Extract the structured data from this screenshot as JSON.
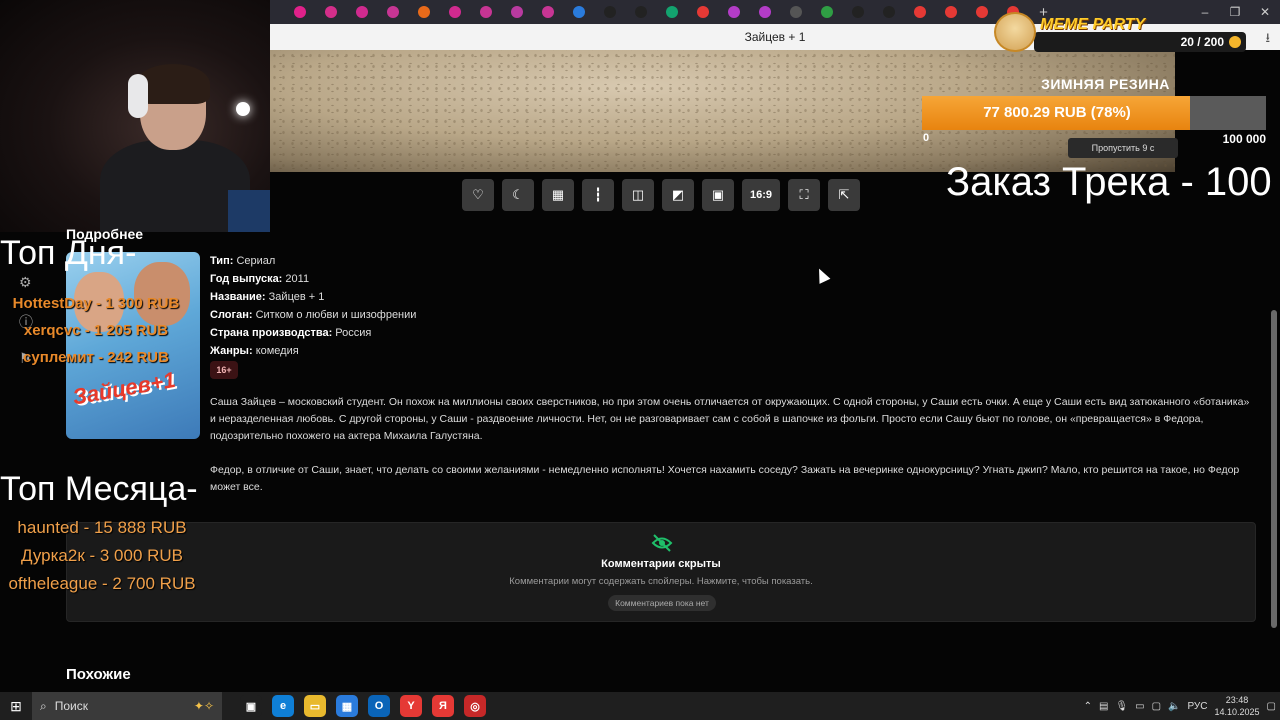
{
  "browser": {
    "tab_colors": [
      "#e0218a",
      "#d42e8a",
      "#d02a8f",
      "#c73594",
      "#e86a1a",
      "#d02a8f",
      "#c73594",
      "#b93aa0",
      "#c73594",
      "#2a7bdc",
      "#222222",
      "#222222",
      "#13a36f",
      "#e53935",
      "#b33cc7",
      "#b33cc7",
      "#555555",
      "#2f9e44",
      "#222222",
      "#222222",
      "#e53935",
      "#e53935",
      "#e53935",
      "#e53935"
    ],
    "new_tab": "+",
    "window_controls": [
      "–",
      "❐",
      "✕"
    ],
    "page_title": "Зайцев + 1",
    "download_icon": "download-icon"
  },
  "overlay": {
    "meme_title": "MEME PARTY",
    "meme_count": "20 / 200",
    "goal_title": "ЗИМНЯЯ РЕЗИНА",
    "goal_amount": "77 800.29 RUB (78%)",
    "goal_fraction": 0.78,
    "goal_min": "0",
    "goal_max": "100 000",
    "skip": "Пропустить 9 с",
    "order": "Заказ Трека - 100",
    "top_day_title": "Топ Дня-",
    "top_day": [
      "HottestDay - 1 300 RUB",
      "xerqcvc - 1 205 RUB",
      "суплемит - 242 RUB"
    ],
    "top_month_title": "Топ Месяца-",
    "top_month": [
      "haunted - 15 888 RUB",
      "Дурка2к - 3 000 RUB",
      "oftheleague - 2 700 RUB"
    ]
  },
  "player_toolbar": [
    "heart-icon",
    "moon-icon",
    "grid-icon",
    "waveform-icon",
    "split-icon",
    "picture-icon",
    "pip-icon",
    "aspect-ratio",
    "fullscreen-icon",
    "open-external-icon"
  ],
  "player_aspect": "16:9",
  "details": {
    "section_title": "Подробнее",
    "poster_logo": "Зайцев+1",
    "rows": [
      {
        "label": "Тип:",
        "value": "Сериал"
      },
      {
        "label": "Год выпуска:",
        "value": "2011"
      },
      {
        "label": "Название:",
        "value": "Зайцев + 1"
      },
      {
        "label": "Слоган:",
        "value": "Ситком о любви и шизофрении"
      },
      {
        "label": "Страна производства:",
        "value": "Россия"
      },
      {
        "label": "Жанры:",
        "value": "комедия"
      }
    ],
    "age": "16+",
    "description_1": "Саша Зайцев – московский студент. Он похож на миллионы своих сверстников, но при этом очень отличается от окружающих. С одной стороны, у Саши есть очки. А еще у Саши есть вид затюканного «ботаника» и неразделенная любовь. С другой стороны, у Саши  - раздвоение личности. Нет, он не разговаривает сам с собой в шапочке из фольги. Просто если Сашу бьют по голове, он «превращается» в Федора, подозрительно похожего на актера Михаила Галустяна.",
    "description_2": "Федор, в отличие от Саши, знает, что делать со своими желаниями - немедленно исполнять! Хочется нахамить соседу? Зажать на вечеринке однокурсницу? Угнать джип? Мало, кто решится на такое, но Федор может все."
  },
  "comments": {
    "title": "Комментарии скрыты",
    "subtitle": "Комментарии могут содержать спойлеры. Нажмите, чтобы показать.",
    "button": "Комментариев пока нет"
  },
  "similar_title": "Похожие",
  "taskbar": {
    "search_placeholder": "Поиск",
    "apps": [
      {
        "name": "task-view-icon",
        "glyph": "▣",
        "color": "#1f1f1f"
      },
      {
        "name": "edge-icon",
        "glyph": "e",
        "color": "#0f7fd6"
      },
      {
        "name": "explorer-icon",
        "glyph": "▭",
        "color": "#e8b92e"
      },
      {
        "name": "store-icon",
        "glyph": "▦",
        "color": "#2a7bdc"
      },
      {
        "name": "outlook-icon",
        "glyph": "O",
        "color": "#0a64b8"
      },
      {
        "name": "yandex-browser-icon",
        "glyph": "Y",
        "color": "#e53935"
      },
      {
        "name": "yandex-icon",
        "glyph": "Я",
        "color": "#e53935"
      },
      {
        "name": "app-icon",
        "glyph": "◎",
        "color": "#c62828"
      }
    ],
    "lang": "РУС",
    "time": "23:48",
    "date": "14.10.2025"
  }
}
